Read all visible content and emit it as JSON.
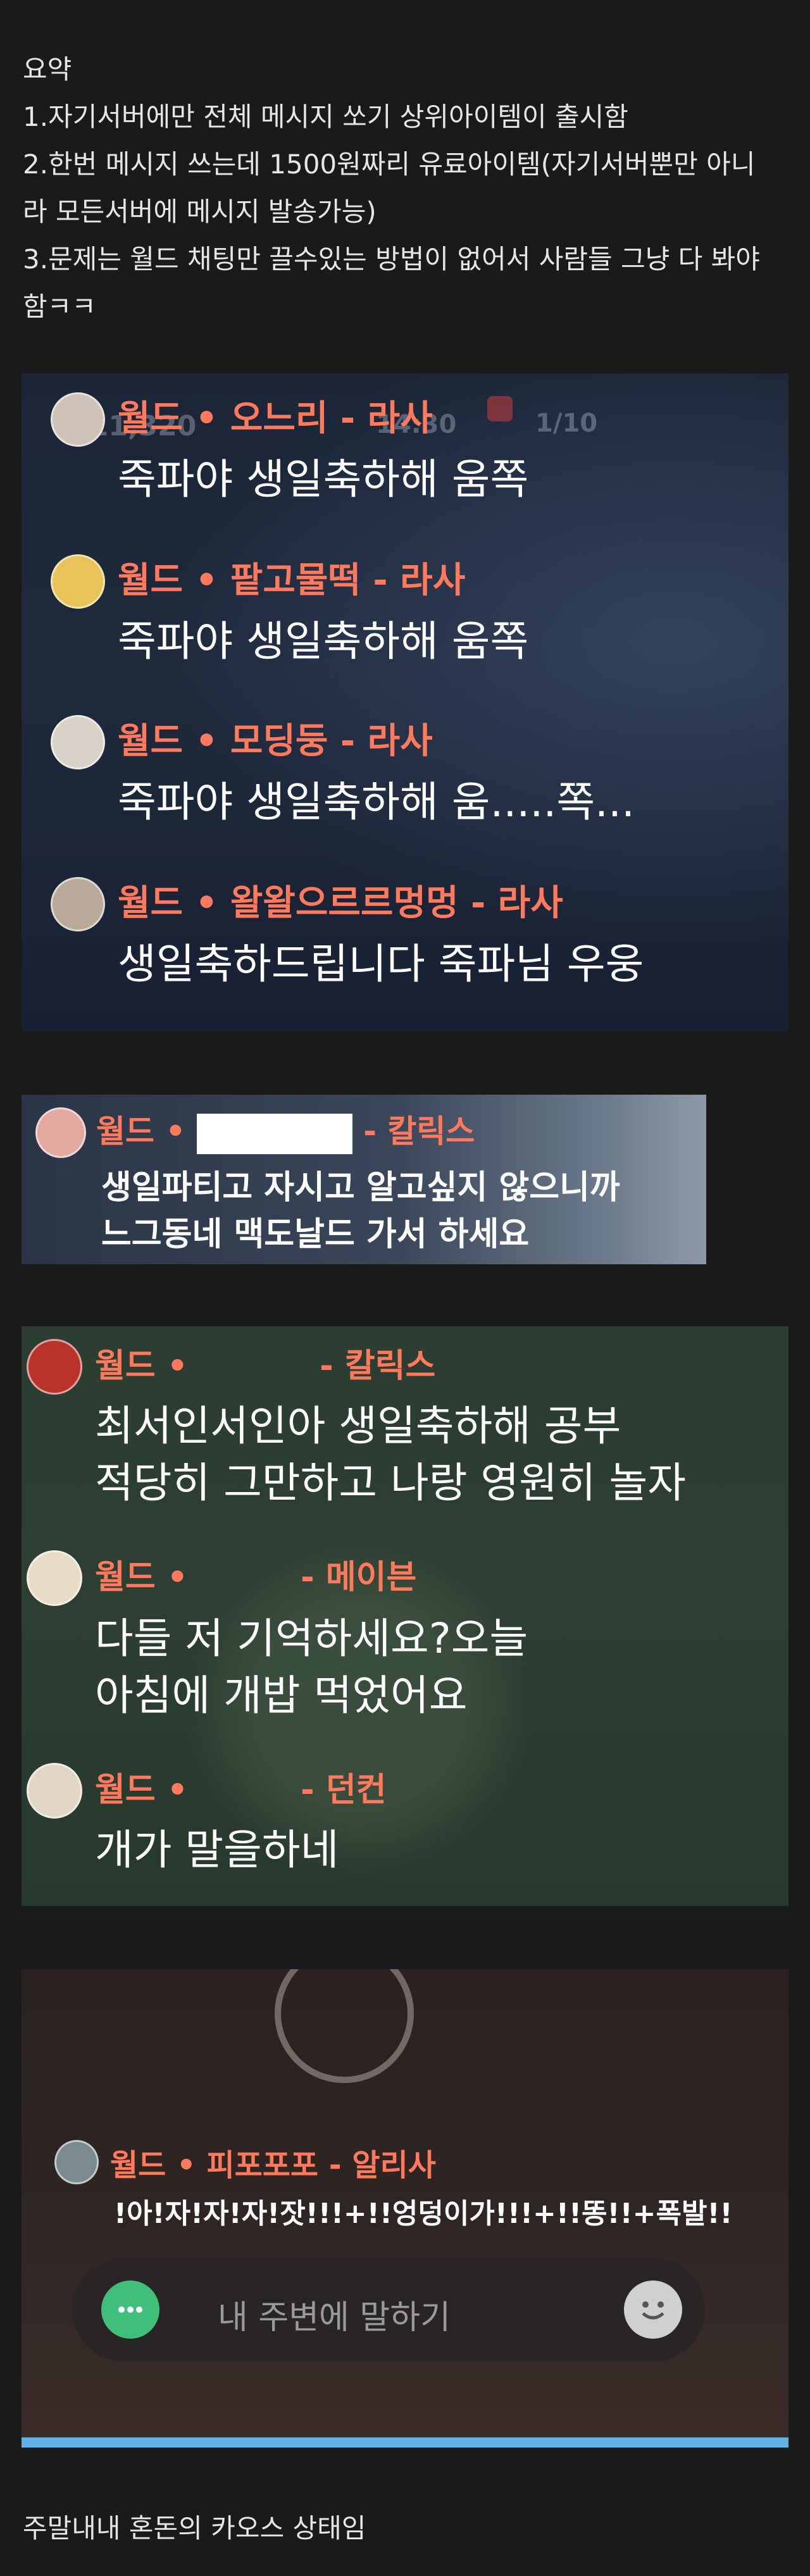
{
  "summary": {
    "lines": [
      "요약",
      "1.자기서버에만 전체 메시지 쏘기 상위아이템이 출시함",
      "2.한번 메시지 쓰는데 1500원짜리 유료아이템(자기서버뿐만 아니",
      "라 모든서버에 메시지 발송가능)",
      "3.문제는 월드 채팅만 끌수있는 방법이 없어서 사람들 그냥 다 봐야",
      "함ㅋㅋ"
    ]
  },
  "shot1": {
    "hud_left": "311,320",
    "hud_mid": "14:30",
    "hud_right": "1/10",
    "messages": [
      {
        "channel": "월드",
        "name": "오느리",
        "server": "라사",
        "text": "죽파야 생일축하해 움쪽",
        "avatar_color": "#cfc2b8"
      },
      {
        "channel": "월드",
        "name": "팥고물떡",
        "server": "라사",
        "text": "죽파야 생일축하해 움쪽",
        "avatar_color": "#e7c35a"
      },
      {
        "channel": "월드",
        "name": "모딩둥",
        "server": "라사",
        "text": "죽파야 생일축하해 움.....쪽...",
        "avatar_color": "#d8d2c8"
      },
      {
        "channel": "월드",
        "name": "왈왈으르르멍멍",
        "server": "라사",
        "text": "생일축하드립니다 죽파님 우웅",
        "avatar_color": "#b9a99a"
      }
    ]
  },
  "shot2": {
    "channel": "월드",
    "server": "칼릭스",
    "line1": "생일파티고 자시고 알고싶지 않으니까",
    "line2": "느그동네 맥도날드 가서 하세요",
    "avatar_color": "#e3a8a0"
  },
  "shot3": {
    "messages": [
      {
        "channel": "월드",
        "server": "칼릭스",
        "line1": "최서인서인아 생일축하해 공부",
        "line2": "적당히 그만하고 나랑 영원히 놀자",
        "avatar_color": "#b8322a"
      },
      {
        "channel": "월드",
        "server": "메이븐",
        "line1": "다들 저 기억하세요?오늘",
        "line2": "아침에 개밥 먹었어요",
        "avatar_color": "#e8dcc6"
      },
      {
        "channel": "월드",
        "server": "던컨",
        "line1": "개가 말을하네",
        "line2": "",
        "avatar_color": "#e2d6c6"
      }
    ]
  },
  "shot4": {
    "channel": "월드",
    "name": "피포포포",
    "server": "알리사",
    "text": "!아!자!자!자!잣!!!+!!엉덩이가!!!+!!똥!!+폭발!!",
    "input_placeholder": "내 주변에 말하기",
    "chat_icon": "chat-bubble-icon",
    "emoji_icon": "emoji-icon",
    "accent": "#5fb2e6"
  },
  "footer": {
    "text": "주말내내 혼돈의 카오스 상태임"
  }
}
